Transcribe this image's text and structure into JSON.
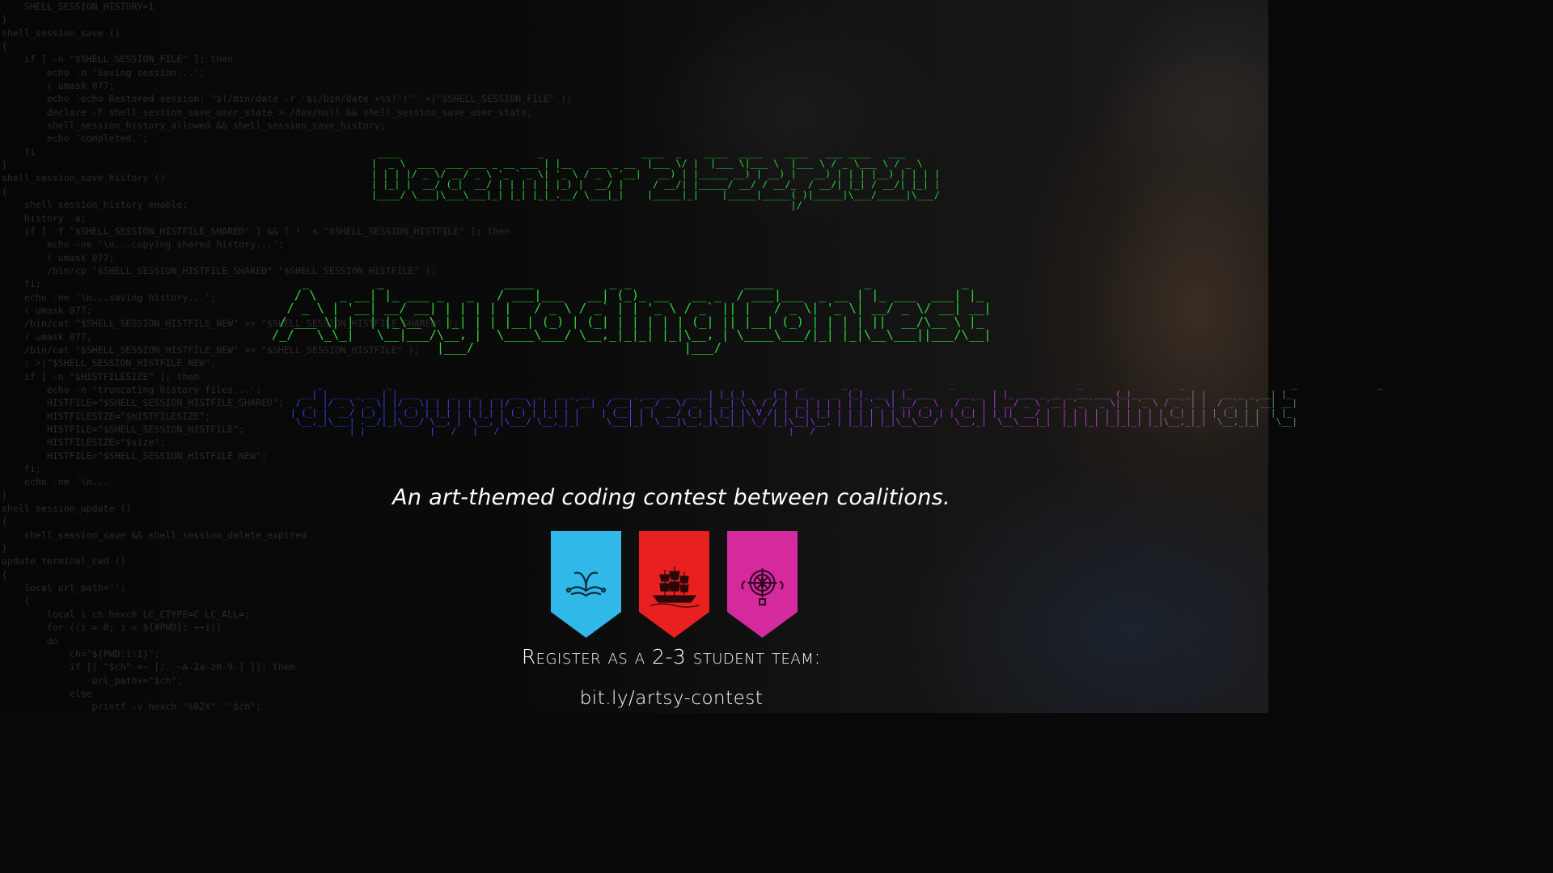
{
  "background_code": "    SHELL_SESSION_HISTORY=1\n}\nshell_session_save ()\n{\n    if [ -n \"$SHELL_SESSION_FILE\" ]; then\n        echo -n 'Saving session...';\n        ( umask 077;\n        echo 'echo Restored session: \"$(/bin/date -r '$(/bin/date +%s)')\"' >|\"$SHELL_SESSION_FILE\" );\n        declare -F shell_session_save_user_state > /dev/null && shell_session_save_user_state;\n        shell_session_history_allowed && shell_session_save_history;\n        echo 'completed.';\n    fi\n}\nshell_session_save_history ()\n{\n    shell_session_history_enable;\n    history -a;\n    if [ -f \"$SHELL_SESSION_HISTFILE_SHARED\" ] && [ ! -s \"$SHELL_SESSION_HISTFILE\" ]; then\n        echo -ne '\\n...copying shared history...';\n        ( umask 077;\n        /bin/cp \"$SHELL_SESSION_HISTFILE_SHARED\" \"$SHELL_SESSION_HISTFILE\" );\n    fi;\n    echo -ne '\\n...saving history...';\n    ( umask 077;\n    /bin/cat \"$SHELL_SESSION_HISTFILE_NEW\" >> \"$SHELL_SESSION_HISTFILE_SHARED\" );\n    ( umask 077;\n    /bin/cat \"$SHELL_SESSION_HISTFILE_NEW\" >> \"$SHELL_SESSION_HISTFILE\" );\n    : >|\"$SHELL_SESSION_HISTFILE_NEW\";\n    if [ -n \"$HISTFILESIZE\" ]; then\n        echo -n 'truncating history files...';\n        HISTFILE=\"$SHELL_SESSION_HISTFILE_SHARED\";\n        HISTFILESIZE=\"$HISTFILESIZE\";\n        HISTFILE=\"$SHELL_SESSION_HISTFILE\";\n        HISTFILESIZE=\"$size\";\n        HISTFILE=\"$SHELL_SESSION_HISTFILE_NEW\";\n    fi;\n    echo -ne '\\n...'\n}\nshell_session_update ()\n{\n    shell_session_save && shell_session_delete_expired\n}\nupdate_terminal_cwd ()\n{\n    local url_path='';\n    {\n        local i ch hexch LC_CTYPE=C LC_ALL=;\n        for ((i = 0; i < ${#PWD}; ++i))\n        do\n            ch=\"${PWD:i:1}\";\n            if [[ \"$ch\" =~ [/._~A-Za-z0-9-] ]]; then\n                url_path+=\"$ch\";\n            else\n                printf -v hexch \"%02X\" \"'$ch\";",
  "date_ascii": " ____                        _                 ____  _    ____  ____    ____   ___ ____   ___  \n|  _ \\  ___  ___ ___ _ __ ___ | |__   ___ _ __  |___ \\/ |  |___ \\|___ \\  |___ \\ / _ \\___ \\ / _ \\ \n| | | |/ _ \\/ __/ _ \\ '_ ` _ \\| '_ \\ / _ \\ '__|   __) | |_____ __) | __) |   __) | | | |__) | | | |\n| |_| |  __/ (_|  __/ | | | | | |_) |  __/ |     / __/| |_____/ __/ / __/_  / __/| |_| / __/| |_| |\n|____/ \\___|\\___\\___|_| |_| |_|_.__/ \\___|_|    |_____|_|    |_____|_____( )|_____|\\___/_____|\\___/ \n                                                                         |/                       ",
  "title_ascii": "    _         _                ____          _ _               ____            _            _   \n   / \\   _ __| |_ ___ _   _   / ___|___   __| (_)_ __   __ _  / ___|___  _ __ | |_ ___  ___| |_ \n  / _ \\ | '__| __/ __| | | | | |   / _ \\ / _` | | '_ \\ / _` || |   / _ \\| '_ \\| __/ _ \\/ __| __|\n / ___ \\| |  | |_\\__ \\ |_| | | |__| (_) | (_| | | | | | (_| || |__| (_) | | | | ||  __/\\__ \\ |_ \n/_/   \\_\\_|   \\__|___/\\__, |  \\____\\___/ \\__,_|_|_| |_|\\__, | \\____\\___/|_| |_|\\__\\___||___/\\__|\n                      |___/                            |___/                                    ",
  "tagline_ascii": "     _            _                                                                        _   _       _ _         _       _                       _                  _                    _               _   \n  __| | ___ _ __ | | ___  _   _   _   _  ___  _   _ _ __    ___ _ __ ___  __ _| |_(_)_   _(_) |_ _   _  (_)_ __ | |_ ___     __ _  | |_ ___ _ __ _ __ ___ (_)_ __   __ _| |   __ _ _ __| |_ \n / _` |/ _ \\ '_ \\| |/ _ \\| | | | | | | |/ _ \\| | | | '__|  / __| '__/ _ \\/ _` | __| \\ \\ / / | __| | | | | | '_ \\| __/ _ \\   / _` | | __/ _ \\ '__| '_ ` _ \\| | '_ \\ / _` | |  / _` | '__| __|\n| (_| |  __/ |_) | | (_) | |_| | | |_| | (_) | |_| | |    | (__| | |  __/ (_| | |_| |\\ V /| | |_| |_| | | | | | | || (_) | | (_| | | ||  __/ |  | | | | | | | | | | (_| | | | (_| | |  | |_ \n \\__,_|\\___| .__/|_|\\___/ \\__, |  \\__, |\\___/ \\__,_|_|     \\___|_|  \\___|\\__,_|\\__|_| \\_/ |_|\\__|\\__, | |_|_| |_|\\__\\___/   \\__,_|  \\__\\___|_|  |_| |_| |_|_|_| |_|\\__,_|_|  \\__,_|_|   \\__|\n           |_|            |___/   |___/                                                      |___/                                                                                           ",
  "tagline": "An art-themed coding contest between coalitions.",
  "coalitions": [
    {
      "color": "#2fb8e8",
      "icon": "whale-tail-icon"
    },
    {
      "color": "#e82020",
      "icon": "sailing-ship-icon"
    },
    {
      "color": "#d42a9e",
      "icon": "compass-icon"
    }
  ],
  "register_text": "Register as a 2-3 student team:",
  "register_link": "bit.ly/artsy-contest",
  "colors": {
    "ascii_green": "#2fd43a",
    "gradient_start": "#2c4cf0",
    "gradient_mid": "#c63ad8",
    "gradient_end": "#2ec94a",
    "text": "#ffffff"
  }
}
